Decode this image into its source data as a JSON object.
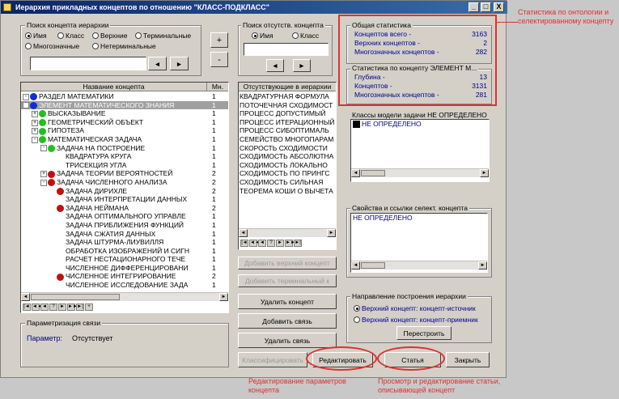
{
  "window": {
    "title": "Иерархия прикладных концептов по отношению \"КЛАСС-ПОДКЛАСС\"",
    "controls": [
      "_",
      "□",
      "X"
    ]
  },
  "search_hierarchy": {
    "label": "Поиск концепта иерархии",
    "radios": [
      {
        "label": "Имя",
        "checked": true
      },
      {
        "label": "Класс",
        "checked": false
      },
      {
        "label": "Верхние",
        "checked": false
      },
      {
        "label": "Терминальные",
        "checked": false
      },
      {
        "label": "Многозначные",
        "checked": false
      },
      {
        "label": "Нетерминальные",
        "checked": false
      }
    ],
    "input_value": "",
    "prev": "◄",
    "next": "►"
  },
  "side_buttons": {
    "plus": "+",
    "minus": "-"
  },
  "tree": {
    "col_name": "Название концепта",
    "col_count": "Мн.",
    "rows": [
      {
        "level": 0,
        "expander": "-",
        "dot": "#1030d0",
        "label": "РАЗДЕЛ МАТЕМАТИКИ",
        "count": "1",
        "selected": false
      },
      {
        "level": 0,
        "expander": "-",
        "dot": "#1030d0",
        "label": "ЭЛЕМЕНТ МАТЕМАТИЧЕСКОГО ЗНАНИЯ",
        "count": "1",
        "selected": true
      },
      {
        "level": 1,
        "expander": "+",
        "dot": "#20c020",
        "label": "ВЫСКАЗЫВАНИЕ",
        "count": "1",
        "selected": false
      },
      {
        "level": 1,
        "expander": "+",
        "dot": "#20c020",
        "label": "ГЕОМЕТРИЧЕСКИЙ ОБЪЕКТ",
        "count": "1",
        "selected": false
      },
      {
        "level": 1,
        "expander": "+",
        "dot": "#20c020",
        "label": "ГИПОТЕЗА",
        "count": "1",
        "selected": false
      },
      {
        "level": 1,
        "expander": "-",
        "dot": "#20c020",
        "label": "МАТЕМАТИЧЕСКАЯ ЗАДАЧА",
        "count": "1",
        "selected": false
      },
      {
        "level": 2,
        "expander": "-",
        "dot": "#20c020",
        "label": "ЗАДАЧА НА ПОСТРОЕНИЕ",
        "count": "1",
        "selected": false
      },
      {
        "level": 3,
        "expander": "",
        "dot": "",
        "label": "КВАДРАТУРА КРУГА",
        "count": "1",
        "selected": false
      },
      {
        "level": 3,
        "expander": "",
        "dot": "",
        "label": "ТРИСЕКЦИЯ УГЛА",
        "count": "1",
        "selected": false
      },
      {
        "level": 2,
        "expander": "+",
        "dot": "#c01010",
        "label": "ЗАДАЧА ТЕОРИИ ВЕРОЯТНОСТЕЙ",
        "count": "2",
        "selected": false
      },
      {
        "level": 2,
        "expander": "-",
        "dot": "#c01010",
        "label": "ЗАДАЧА ЧИСЛЕННОГО АНАЛИЗА",
        "count": "2",
        "selected": false
      },
      {
        "level": 3,
        "expander": "",
        "dot": "#c01010",
        "label": "ЗАДАЧА ДИРИХЛЕ",
        "count": "2",
        "selected": false
      },
      {
        "level": 3,
        "expander": "",
        "dot": "",
        "label": "ЗАДАЧА ИНТЕРПРЕТАЦИИ ДАННЫХ",
        "count": "1",
        "selected": false
      },
      {
        "level": 3,
        "expander": "",
        "dot": "#c01010",
        "label": "ЗАДАЧА НЕЙМАНА",
        "count": "2",
        "selected": false
      },
      {
        "level": 3,
        "expander": "",
        "dot": "",
        "label": "ЗАДАЧА ОПТИМАЛЬНОГО УПРАВЛЕ",
        "count": "1",
        "selected": false
      },
      {
        "level": 3,
        "expander": "",
        "dot": "",
        "label": "ЗАДАЧА ПРИБЛИЖЕНИЯ ФУНКЦИЙ",
        "count": "1",
        "selected": false
      },
      {
        "level": 3,
        "expander": "",
        "dot": "",
        "label": "ЗАДАЧА СЖАТИЯ ДАННЫХ",
        "count": "1",
        "selected": false
      },
      {
        "level": 3,
        "expander": "",
        "dot": "",
        "label": "ЗАДАЧА ШТУРМА-ЛИУВИЛЛЯ",
        "count": "1",
        "selected": false
      },
      {
        "level": 3,
        "expander": "",
        "dot": "",
        "label": "ОБРАБОТКА ИЗОБРАЖЕНИЙ И СИГН",
        "count": "1",
        "selected": false
      },
      {
        "level": 3,
        "expander": "",
        "dot": "",
        "label": "РАСЧЕТ НЕСТАЦИОНАРНОГО ТЕЧЕ",
        "count": "1",
        "selected": false
      },
      {
        "level": 3,
        "expander": "",
        "dot": "",
        "label": "ЧИСЛЕННОЕ ДИФФЕРЕНЦИРОВАНИ",
        "count": "1",
        "selected": false
      },
      {
        "level": 3,
        "expander": "",
        "dot": "#c01010",
        "label": "ЧИСЛЕННОЕ ИНТЕГРИРОВАНИЕ",
        "count": "2",
        "selected": false
      },
      {
        "level": 3,
        "expander": "",
        "dot": "",
        "label": "ЧИСЛЕННОЕ ИССЛЕДОВАНИЕ ЗАДА",
        "count": "1",
        "selected": false
      }
    ],
    "nav": [
      "|◄",
      "◄◄",
      "◄",
      "?",
      "►",
      "►►",
      "►|",
      "+"
    ]
  },
  "link_param": {
    "label": "Параметризация связи",
    "param_label": "Параметр:",
    "param_value": "Отсутствует"
  },
  "search_absent": {
    "label": "Поиск отсутств. концепта",
    "radios": [
      {
        "label": "Имя",
        "checked": true
      },
      {
        "label": "Класс",
        "checked": false
      }
    ],
    "input_value": "",
    "prev": "◄",
    "next": "►"
  },
  "absent_list": {
    "header": "Отсутствующие в иерархии",
    "items": [
      "КВАДРАТУРНАЯ ФОРМУЛА",
      "ПОТОЧЕЧНАЯ СХОДИМОСТ",
      "ПРОЦЕСС ДОПУСТИМЫЙ",
      "ПРОЦЕСС ИТЕРАЦИОННЫЙ",
      "ПРОЦЕСС СИБОПТИМАЛЬ",
      "СЕМЕЙСТВО МНОГОПАРАМ",
      "СКОРОСТЬ СХОДИМОСТИ",
      "СХОДИМОСТЬ АБСОЛЮТНА",
      "СХОДИМОСТЬ ЛОКАЛЬНО",
      "СХОДИМОСТЬ ПО ПРИНГС",
      "СХОДИМОСТЬ СИЛЬНАЯ",
      "ТЕОРЕМА КОШИ О ВЫЧЕТА"
    ],
    "nav": [
      "|◄",
      "◄◄",
      "◄",
      "?",
      "►",
      "►►",
      "►|"
    ]
  },
  "middle_buttons": {
    "add_top": "Добавить верхний концепт",
    "add_terminal": "Добавить терминальный к",
    "delete_concept": "Удалить концепт",
    "add_link": "Добавить связь",
    "delete_link": "Удалить связь",
    "classify": "Классифицировать"
  },
  "stats": {
    "general_label": "Общая статистика",
    "general": [
      {
        "label": "Концептов всего -",
        "value": "3163"
      },
      {
        "label": "Верхних концептов -",
        "value": "2"
      },
      {
        "label": "Многозначных концептов -",
        "value": "282"
      }
    ],
    "concept_label": "Статистика по концепту ЭЛЕМЕНТ М...",
    "concept": [
      {
        "label": "Глубина -",
        "value": "13"
      },
      {
        "label": "Концептов -",
        "value": "3131"
      },
      {
        "label": "Многозначных концептов -",
        "value": "281"
      }
    ]
  },
  "model_classes": {
    "label": "Классы модели задачи НЕ ОПРЕДЕЛЕНО",
    "item": "НЕ ОПРЕДЕЛЕНО"
  },
  "props": {
    "label": "Свойства и ссылки селект. концепта",
    "item": "НЕ ОПРЕДЕЛЕНО"
  },
  "direction": {
    "label": "Направление построения иерархии",
    "radios": [
      {
        "label": "Верхний концепт: концепт-источник",
        "checked": true
      },
      {
        "label": "Верхний концепт: концепт-приемник",
        "checked": false
      }
    ],
    "rebuild": "Перестроить"
  },
  "bottom_buttons": {
    "edit": "Редактировать",
    "article": "Статья",
    "close": "Закрыть"
  },
  "annotations": {
    "stats_note": "Статистика по онтологии и селектированному концепту",
    "edit_note": "Редактирование параметров концепта",
    "article_note": "Просмотр и редактирование статьи, описывающей концепт"
  },
  "colors": {
    "annotation": "#e03030",
    "title_bar": "#0a246a",
    "stat_text": "#00008b"
  }
}
